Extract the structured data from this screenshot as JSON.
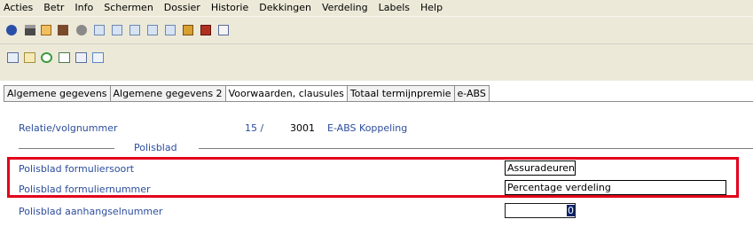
{
  "menu": [
    "Acties",
    "Betr",
    "Info",
    "Schermen",
    "Dossier",
    "Historie",
    "Dekkingen",
    "Verdeling",
    "Labels",
    "Help"
  ],
  "toolbar_icons": [
    "help-icon",
    "print-icon",
    "home-icon",
    "book-icon",
    "record-icon",
    "page1-icon",
    "page2-icon",
    "page3-icon",
    "page4-icon",
    "page5-icon",
    "edit-icon",
    "stop-icon",
    "info-icon"
  ],
  "toolbar2_icons": [
    "calendar-icon",
    "notes-icon",
    "refresh-icon",
    "add-icon",
    "export-icon",
    "document-icon"
  ],
  "tabs": [
    {
      "label": "Algemene gegevens",
      "active": false
    },
    {
      "label": "Algemene gegevens 2",
      "active": false
    },
    {
      "label": "Voorwaarden, clausules",
      "active": true
    },
    {
      "label": "Totaal termijnpremie",
      "active": false
    },
    {
      "label": "e-ABS",
      "active": false
    }
  ],
  "relatie": {
    "label": "Relatie/volgnummer",
    "number": "15 /",
    "volgnummer": "3001",
    "koppeling": "E-ABS Koppeling"
  },
  "section": {
    "title": "Polisblad"
  },
  "fields": {
    "formuliersoort": {
      "label": "Polisblad formuliersoort",
      "value": "Assuradeurenv"
    },
    "formuliernummer": {
      "label": "Polisblad formuliernummer",
      "value": "Percentage verdeling"
    },
    "aanhangselnummer": {
      "label": "Polisblad aanhangselnummer",
      "value": "0"
    }
  },
  "colors": {
    "label": "#2c4d9c",
    "highlight": "#e2001a",
    "chrome": "#ece9d8"
  }
}
